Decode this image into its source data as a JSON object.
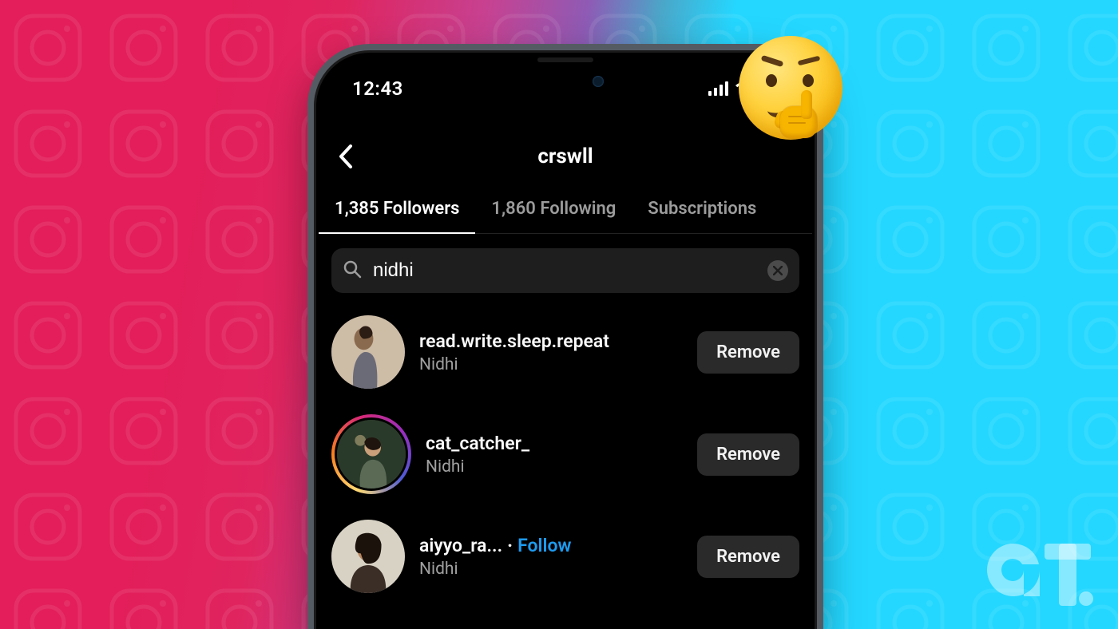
{
  "status_bar": {
    "time": "12:43"
  },
  "header": {
    "title": "crswll"
  },
  "tabs": {
    "items": [
      {
        "label": "1,385 Followers",
        "active": true
      },
      {
        "label": "1,860 Following",
        "active": false
      },
      {
        "label": "Subscriptions",
        "active": false
      }
    ]
  },
  "search": {
    "value": "nidhi"
  },
  "actions": {
    "remove_label": "Remove",
    "follow_label": "Follow"
  },
  "followers": [
    {
      "username": "read.write.sleep.repeat",
      "display_name": "Nidhi",
      "has_story": false,
      "show_follow": false
    },
    {
      "username": "cat_catcher_",
      "display_name": "Nidhi",
      "has_story": true,
      "show_follow": false
    },
    {
      "username": "aiyyo_ra...",
      "display_name": "Nidhi",
      "has_story": false,
      "show_follow": true
    }
  ],
  "decor": {
    "emoji": "🤔",
    "brand": "GT"
  }
}
